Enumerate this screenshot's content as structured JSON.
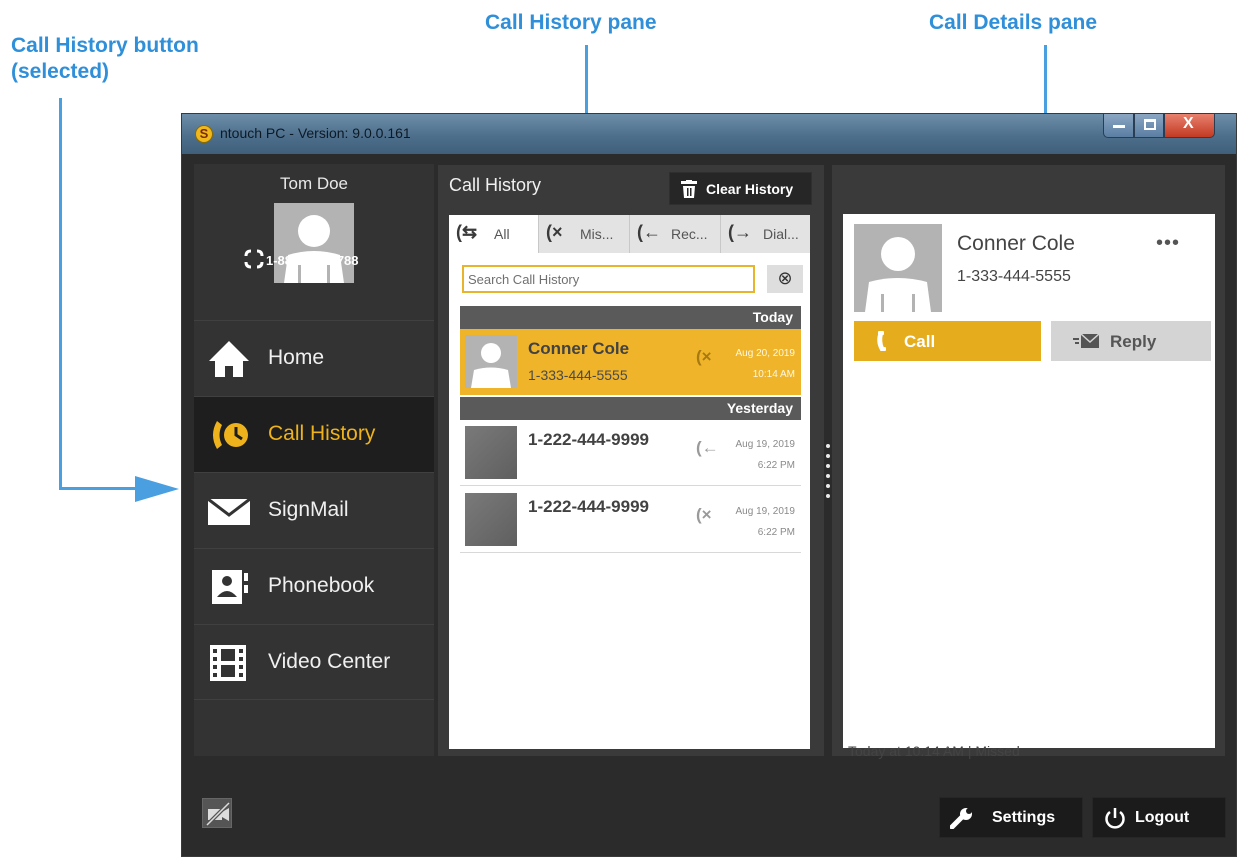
{
  "annotations": {
    "call_history_button": "Call History button\n(selected)",
    "call_history_pane": "Call History pane",
    "call_details_pane": "Call Details pane"
  },
  "window": {
    "title": "ntouch PC  -  Version: 9.0.0.161",
    "controls": [
      "minimize",
      "maximize",
      "close"
    ]
  },
  "user": {
    "name": "Tom Doe",
    "phone": "1-888-999-8788"
  },
  "nav": {
    "items": [
      {
        "label": "Home",
        "icon": "home-icon",
        "selected": false
      },
      {
        "label": "Call History",
        "icon": "call-history-icon",
        "selected": true
      },
      {
        "label": "SignMail",
        "icon": "envelope-icon",
        "selected": false
      },
      {
        "label": "Phonebook",
        "icon": "phonebook-icon",
        "selected": false
      },
      {
        "label": "Video Center",
        "icon": "film-icon",
        "selected": false
      }
    ]
  },
  "call_history": {
    "title": "Call History",
    "clear_label": "Clear History",
    "tabs": [
      {
        "label": "All",
        "icon": "all-calls-icon",
        "selected": true
      },
      {
        "label": "Mis...",
        "icon": "missed-call-icon",
        "selected": false
      },
      {
        "label": "Rec...",
        "icon": "received-call-icon",
        "selected": false
      },
      {
        "label": "Dial...",
        "icon": "dialed-call-icon",
        "selected": false
      }
    ],
    "search_placeholder": "Search Call History",
    "groups": [
      {
        "header": "Today",
        "entries": [
          {
            "name": "Conner Cole",
            "number": "1-333-444-5555",
            "date": "Aug 20, 2019",
            "time": "10:14 AM",
            "type": "missed",
            "selected": true
          }
        ]
      },
      {
        "header": "Yesterday",
        "entries": [
          {
            "name": "1-222-444-9999",
            "number": "",
            "date": "Aug 19, 2019",
            "time": "6:22 PM",
            "type": "received",
            "selected": false
          },
          {
            "name": "1-222-444-9999",
            "number": "",
            "date": "Aug 19, 2019",
            "time": "6:22 PM",
            "type": "missed",
            "selected": false
          }
        ]
      }
    ]
  },
  "details": {
    "name": "Conner Cole",
    "phone": "1-333-444-5555",
    "more_label": "•••",
    "call_label": "Call",
    "reply_label": "Reply",
    "status": "Today at 10:14 AM  |  Missed"
  },
  "bottom": {
    "settings_label": "Settings",
    "logout_label": "Logout"
  },
  "colors": {
    "accent": "#efb429",
    "window_bg": "#2b2b2b",
    "annotation": "#2f8fd8"
  }
}
